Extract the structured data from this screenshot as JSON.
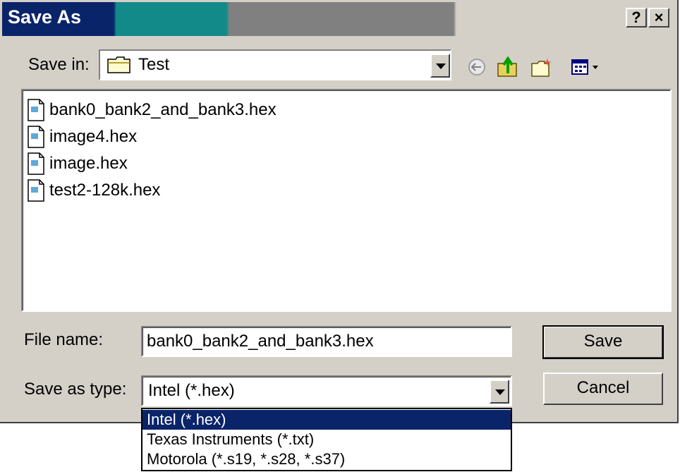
{
  "window": {
    "title": "Save As",
    "help_label": "?",
    "close_label": "×"
  },
  "save_in": {
    "label": "Save in:",
    "folder": "Test"
  },
  "files": [
    {
      "name": "bank0_bank2_and_bank3.hex"
    },
    {
      "name": "image4.hex"
    },
    {
      "name": "image.hex"
    },
    {
      "name": "test2-128k.hex"
    }
  ],
  "file_name": {
    "label": "File name:",
    "value": "bank0_bank2_and_bank3.hex"
  },
  "save_as_type": {
    "label": "Save as type:",
    "selected": "Intel  (*.hex)",
    "options": [
      "Intel  (*.hex)",
      "Texas Instruments (*.txt)",
      "Motorola  (*.s19, *.s28, *.s37)"
    ]
  },
  "buttons": {
    "save": "Save",
    "cancel": "Cancel"
  },
  "toolbar": {
    "icons": [
      "back-icon",
      "up-folder-icon",
      "new-folder-icon",
      "view-menu-icon"
    ]
  },
  "colors": {
    "title_active": "#0a246a",
    "title_mid": "#138a8a",
    "face": "#d4d0c8",
    "selection": "#0a246a"
  }
}
